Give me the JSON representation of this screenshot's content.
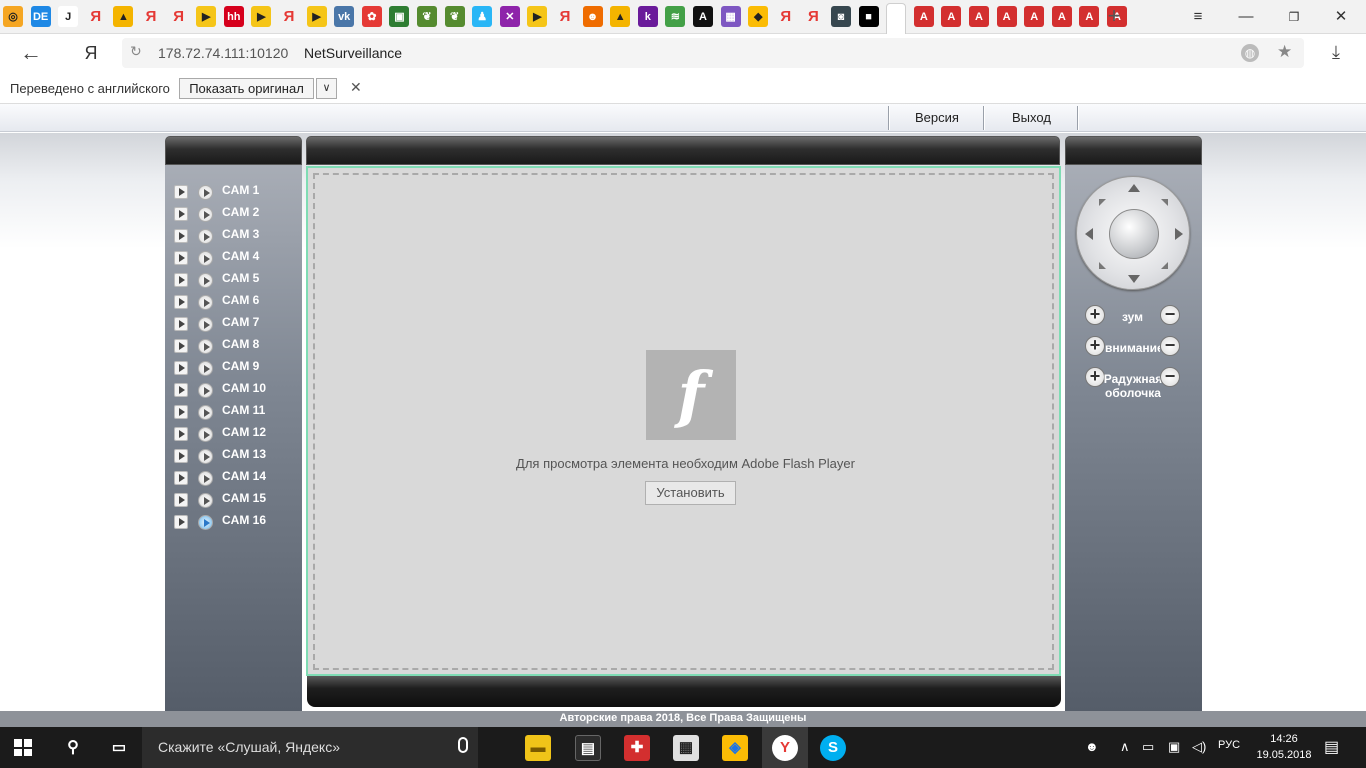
{
  "browser": {
    "tabs": [
      {
        "icon": "target-icon",
        "bg": "#f5a623",
        "glyph": "◎"
      },
      {
        "icon": "de-icon",
        "bg": "#1e88e5",
        "glyph": "DE"
      },
      {
        "icon": "j-icon",
        "bg": "#ffffff",
        "glyph": "J"
      },
      {
        "icon": "yandex-icon",
        "bg": "#f2f2f2",
        "glyph": "Я"
      },
      {
        "icon": "image-icon",
        "bg": "#f4b400",
        "glyph": "▲"
      },
      {
        "icon": "yandex-icon",
        "bg": "#f2f2f2",
        "glyph": "Я"
      },
      {
        "icon": "yandex-icon",
        "bg": "#f2f2f2",
        "glyph": "Я"
      },
      {
        "icon": "play-icon",
        "bg": "#f5c518",
        "glyph": "▶"
      },
      {
        "icon": "hh-icon",
        "bg": "#d6001c",
        "glyph": "hh"
      },
      {
        "icon": "play-icon",
        "bg": "#f5c518",
        "glyph": "▶"
      },
      {
        "icon": "yandex-icon",
        "bg": "#f2f2f2",
        "glyph": "Я"
      },
      {
        "icon": "play-icon",
        "bg": "#f5c518",
        "glyph": "▶"
      },
      {
        "icon": "vk-icon",
        "bg": "#4a76a8",
        "glyph": "vk"
      },
      {
        "icon": "flower-icon",
        "bg": "#e53935",
        "glyph": "✿"
      },
      {
        "icon": "doc-icon",
        "bg": "#2e7d32",
        "glyph": "▣"
      },
      {
        "icon": "leaf-icon",
        "bg": "#558b2f",
        "glyph": "❦"
      },
      {
        "icon": "leaf-icon",
        "bg": "#558b2f",
        "glyph": "❦"
      },
      {
        "icon": "person-icon",
        "bg": "#29b6f6",
        "glyph": "♟"
      },
      {
        "icon": "cross-icon",
        "bg": "#8e24aa",
        "glyph": "✕"
      },
      {
        "icon": "play-icon",
        "bg": "#f5c518",
        "glyph": "▶"
      },
      {
        "icon": "yandex-icon",
        "bg": "#f2f2f2",
        "glyph": "Я"
      },
      {
        "icon": "fox-icon",
        "bg": "#ef6c00",
        "glyph": "☻"
      },
      {
        "icon": "image-icon",
        "bg": "#f4b400",
        "glyph": "▲"
      },
      {
        "icon": "k-icon",
        "bg": "#6a1b9a",
        "glyph": "k"
      },
      {
        "icon": "hash-icon",
        "bg": "#43a047",
        "glyph": "≋"
      },
      {
        "icon": "a-icon",
        "bg": "#111111",
        "glyph": "A"
      },
      {
        "icon": "photo-icon",
        "bg": "#7e57c2",
        "glyph": "▦"
      },
      {
        "icon": "drive-icon",
        "bg": "#fbbc05",
        "glyph": "◆"
      },
      {
        "icon": "yandex-icon",
        "bg": "#f2f2f2",
        "glyph": "Я"
      },
      {
        "icon": "yandex-icon",
        "bg": "#f2f2f2",
        "glyph": "Я"
      },
      {
        "icon": "video-icon",
        "bg": "#37474f",
        "glyph": "◙"
      },
      {
        "icon": "camera-icon",
        "bg": "#000000",
        "glyph": "■"
      },
      {
        "icon": "page-icon",
        "bg": "#ffffff",
        "glyph": ""
      },
      {
        "icon": "pdf-icon",
        "bg": "#d32f2f",
        "glyph": "A"
      },
      {
        "icon": "pdf-icon",
        "bg": "#d32f2f",
        "glyph": "A"
      },
      {
        "icon": "pdf-icon",
        "bg": "#d32f2f",
        "glyph": "A"
      },
      {
        "icon": "pdf-icon",
        "bg": "#d32f2f",
        "glyph": "A"
      },
      {
        "icon": "pdf-icon",
        "bg": "#d32f2f",
        "glyph": "A"
      },
      {
        "icon": "pdf-icon",
        "bg": "#d32f2f",
        "glyph": "A"
      },
      {
        "icon": "pdf-icon",
        "bg": "#d32f2f",
        "glyph": "A"
      },
      {
        "icon": "pdf-icon",
        "bg": "#d32f2f",
        "glyph": "A"
      }
    ],
    "url_host": "178.72.74.111:10120",
    "url_title": "NetSurveillance",
    "back": "←",
    "yandex": "Я"
  },
  "translate_bar": {
    "text": "Переведено с английского",
    "show_original": "Показать оригинал"
  },
  "nav": {
    "version": "Версия",
    "logout": "Выход"
  },
  "cameras": [
    "CAM 1",
    "CAM 2",
    "CAM 3",
    "CAM 4",
    "CAM 5",
    "CAM 6",
    "CAM 7",
    "CAM 8",
    "CAM 9",
    "CAM 10",
    "CAM 11",
    "CAM 12",
    "CAM 13",
    "CAM 14",
    "CAM 15",
    "CAM 16"
  ],
  "active_camera": "CAM 16",
  "flash": {
    "message": "Для просмотра элемента необходим Adobe Flash Player",
    "install": "Установить"
  },
  "ptz": {
    "zoom": "зум",
    "focus": "внимание",
    "iris": "Радужная оболочка"
  },
  "footer": "Авторские права 2018, Все Права Защищены",
  "taskbar": {
    "search": "Скажите «Слушай, Яндекс»",
    "lang": "РУС",
    "time": "14:26",
    "date": "19.05.2018"
  }
}
